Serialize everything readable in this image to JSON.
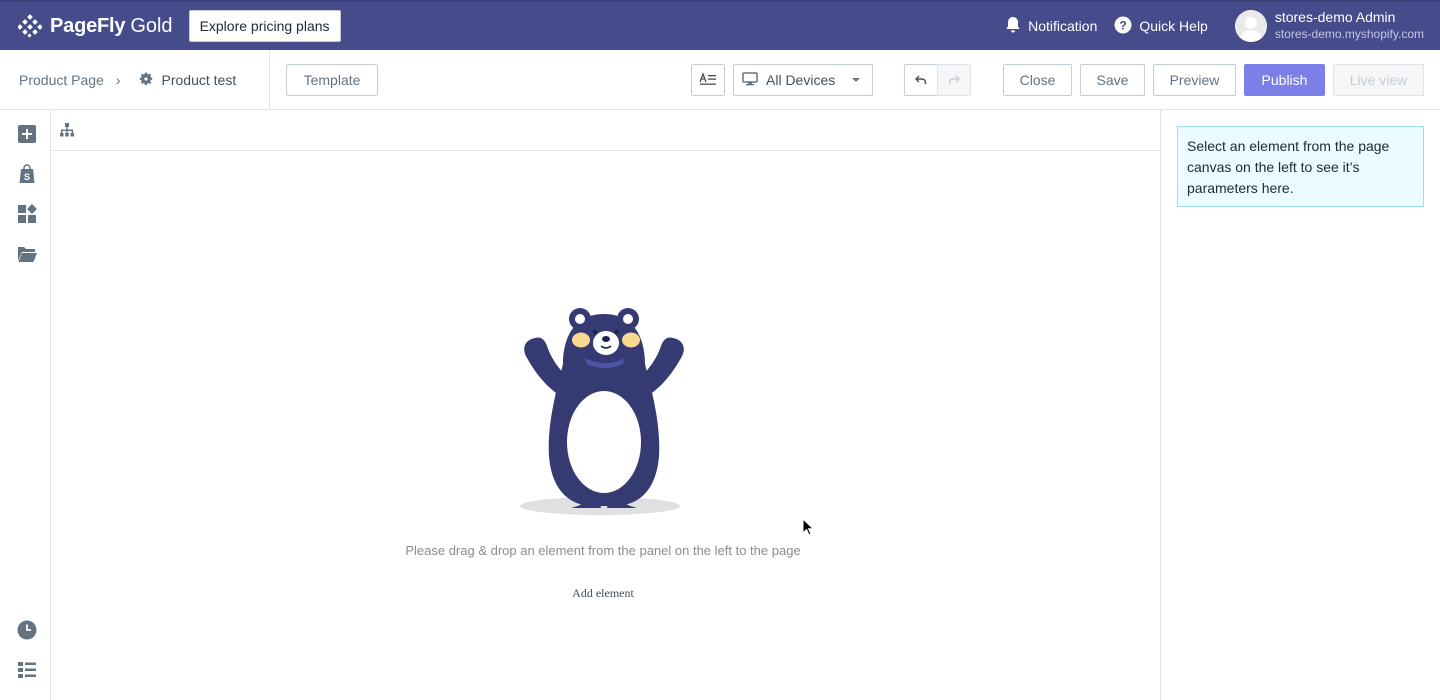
{
  "topbar": {
    "brand_name": "PageFly",
    "brand_tier": "Gold",
    "pricing_button": "Explore pricing plans",
    "notification": "Notification",
    "quick_help": "Quick Help",
    "user_name": "stores-demo Admin",
    "user_shop": "stores-demo.myshopify.com",
    "icons": [
      "pagefly-logo-icon",
      "bell-icon",
      "help-circle-icon",
      "avatar-icon"
    ]
  },
  "toolbar": {
    "breadcrumb_root": "Product Page",
    "breadcrumb_separator": "›",
    "breadcrumb_current": "Product test",
    "template_button": "Template",
    "device_select": "All Devices",
    "close_button": "Close",
    "save_button": "Save",
    "preview_button": "Preview",
    "publish_button": "Publish",
    "live_view_button": "Live view",
    "icons": [
      "gear-icon",
      "text-format-icon",
      "monitor-icon",
      "chevron-down-icon",
      "undo-icon",
      "redo-icon"
    ]
  },
  "sidebar": {
    "icons": [
      "add-element-icon",
      "shopify-bag-icon",
      "sections-icon",
      "folder-icon",
      "history-icon",
      "layers-list-icon"
    ]
  },
  "canvas": {
    "empty_message": "Please drag & drop an element from the panel on the left to the page",
    "add_element": "Add element",
    "icons": [
      "page-tree-icon",
      "bear-illustration",
      "mouse-cursor-icon"
    ]
  },
  "panel": {
    "note": "Select an element from the page canvas on the left to see it’s parameters here."
  },
  "colors": {
    "topbar": "#454b8b",
    "primary": "#7c7fe8",
    "bear": "#353a73",
    "note_bg": "#eafcff",
    "note_border": "#9cddf0"
  }
}
